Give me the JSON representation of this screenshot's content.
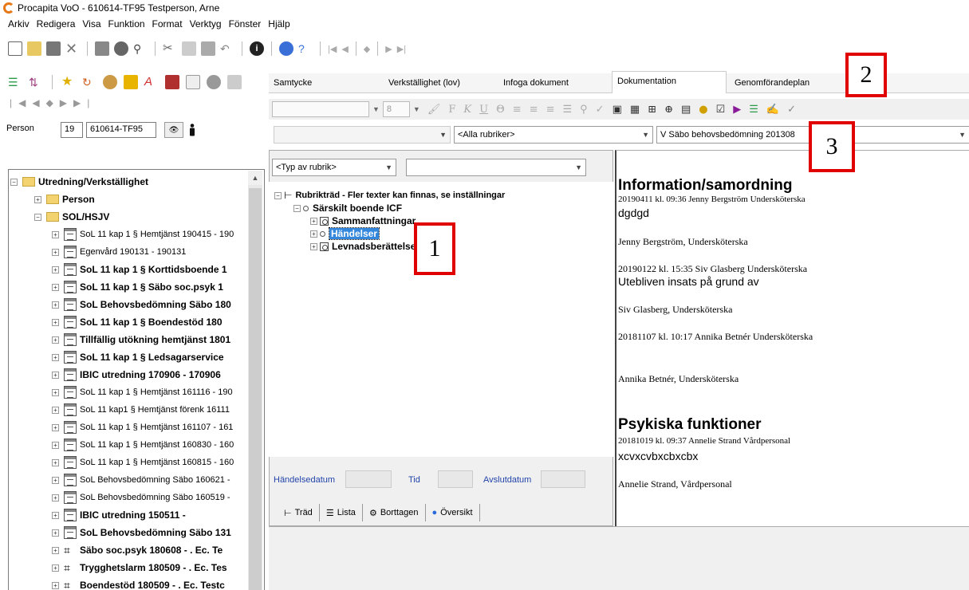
{
  "window": {
    "title": "Procapita VoO - 610614-TF95 Testperson, Arne"
  },
  "menu": [
    "Arkiv",
    "Redigera",
    "Visa",
    "Funktion",
    "Format",
    "Verktyg",
    "Fönster",
    "Hjälp"
  ],
  "person": {
    "label": "Person",
    "number": "19",
    "id": "610614-TF95"
  },
  "left_tree": {
    "root": "Utredning/Verkställighet",
    "person": "Person",
    "group": "SOL/HSJV",
    "items": [
      {
        "label": "SoL 11 kap 1 § Hemtjänst 190415 - 190",
        "bold": false
      },
      {
        "label": "Egenvård 190131 - 190131",
        "bold": false
      },
      {
        "label": "SoL 11 kap 1 § Korttidsboende 1",
        "bold": true
      },
      {
        "label": "SoL 11 kap 1 § Säbo soc.psyk 1",
        "bold": true
      },
      {
        "label": "SoL Behovsbedömning Säbo 180",
        "bold": true
      },
      {
        "label": "SoL 11 kap 1 § Boendestöd 180",
        "bold": true
      },
      {
        "label": "Tillfällig utökning hemtjänst 1801",
        "bold": true
      },
      {
        "label": "SoL 11 kap 1 § Ledsagarservice",
        "bold": true
      },
      {
        "label": "IBIC utredning 170906 - 170906",
        "bold": true
      },
      {
        "label": "SoL 11 kap 1 § Hemtjänst 161116 - 190",
        "bold": false
      },
      {
        "label": "SoL 11 kap1 § Hemtjänst förenk 16111",
        "bold": false
      },
      {
        "label": "SoL 11 kap 1 § Hemtjänst 161107 - 161",
        "bold": false
      },
      {
        "label": "SoL 11 kap 1 § Hemtjänst 160830 - 160",
        "bold": false
      },
      {
        "label": "SoL 11 kap 1 § Hemtjänst 160815 - 160",
        "bold": false
      },
      {
        "label": "SoL Behovsbedömning Säbo 160621 -",
        "bold": false
      },
      {
        "label": "SoL Behovsbedömning Säbo 160519 -",
        "bold": false
      },
      {
        "label": "IBIC utredning 150511 -",
        "bold": true
      },
      {
        "label": "SoL Behovsbedömning Säbo 131",
        "bold": true
      },
      {
        "label": "Säbo soc.psyk 180608 - . Ec. Te",
        "bold": true,
        "grid": true
      },
      {
        "label": "Trygghetslarm 180509 - . Ec. Tes",
        "bold": true,
        "grid": true
      },
      {
        "label": "Boendestöd 180509 - . Ec. Testc",
        "bold": true,
        "grid": true
      }
    ]
  },
  "tabs": [
    "Samtycke",
    "Verkställighet (lov)",
    "Infoga dokument",
    "Dokumentation",
    "Genomförandeplan"
  ],
  "format_bar": {
    "font_size": "8",
    "letters": [
      "F",
      "K",
      "U",
      "Θ"
    ]
  },
  "filters": {
    "rubriker": "<Alla rubriker>",
    "document": "V Säbo behovsbedömning 201308",
    "typ": "<Typ av rubrik>"
  },
  "mid_tree": {
    "root": "Rubrikträd - Fler texter kan finnas, se inställningar",
    "node": "Särskilt boende ICF",
    "children": [
      "Sammanfattningar",
      "Händelser",
      "Levnadsberättelse"
    ]
  },
  "fields": {
    "event_date": "Händelsedatum",
    "time": "Tid",
    "end_date": "Avslutdatum"
  },
  "bottom_tabs": [
    "Träd",
    "Lista",
    "Borttagen",
    "Översikt"
  ],
  "doc": {
    "h1": "Information/samordning",
    "entries": [
      {
        "meta": "20190411 kl. 09:36   Jenny Bergström   Undersköterska",
        "text": "dgdgd",
        "sign": "Jenny Bergström, Undersköterska"
      },
      {
        "meta": "20190122 kl. 15:35   Siv Glasberg   Undersköterska",
        "text": "Utebliven insats på grund av",
        "sign": "Siv Glasberg, Undersköterska"
      },
      {
        "meta": "20181107 kl. 10:17   Annika Betnér   Undersköterska",
        "text": "",
        "sign": "Annika Betnér, Undersköterska"
      }
    ],
    "h2": "Psykiska funktioner",
    "entry2": {
      "meta": "20181019 kl. 09:37   Annelie Strand   Vårdpersonal",
      "text": "xcvxcvbxcbxcbx",
      "sign": "Annelie Strand, Vårdpersonal"
    }
  },
  "callouts": [
    "1",
    "2",
    "3"
  ]
}
